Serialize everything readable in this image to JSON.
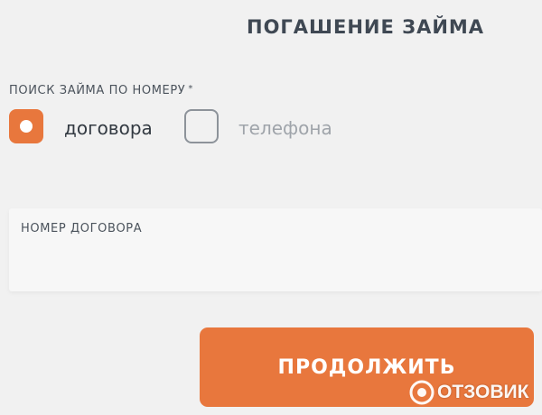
{
  "header": {
    "title": "ПОГАШЕНИЕ ЗАЙМА"
  },
  "search": {
    "label": "ПОИСК ЗАЙМА ПО НОМЕРУ",
    "required_mark": "*",
    "options": [
      {
        "label": "договора",
        "checked": true
      },
      {
        "label": "телефона",
        "checked": false
      }
    ]
  },
  "contract_field": {
    "label": "НОМЕР ДОГОВОРА",
    "value": ""
  },
  "continue_button": {
    "label": "ПРОДОЛЖИТЬ"
  },
  "watermark": {
    "text": "ОТЗОВИК"
  },
  "colors": {
    "accent": "#e8773d",
    "background": "#f1f1f1",
    "title_text": "#3f4853",
    "muted_text": "#9fa4aa"
  }
}
